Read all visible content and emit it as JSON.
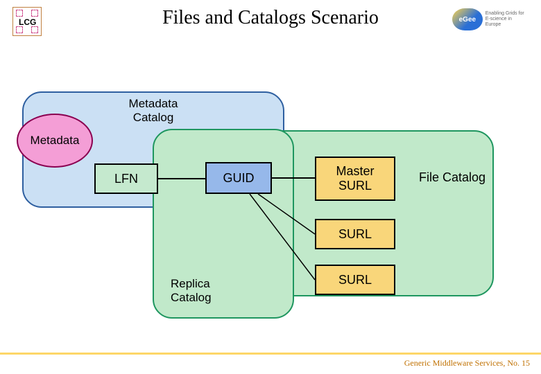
{
  "header": {
    "lcg_label": "LCG",
    "title": "Files and Catalogs Scenario",
    "egee_mark": "eGee",
    "egee_tagline_1": "Enabling Grids for",
    "egee_tagline_2": "E-science in Europe"
  },
  "diagram": {
    "metadata_catalog_label": "Metadata\nCatalog",
    "metadata_ellipse_label": "Metadata",
    "replica_catalog_label": "Replica\nCatalog",
    "file_catalog_label": "File Catalog",
    "nodes": {
      "lfn": "LFN",
      "guid": "GUID",
      "master_surl": "Master\nSURL",
      "surl_2": "SURL",
      "surl_3": "SURL"
    }
  },
  "footer": {
    "text": "Generic Middleware Services, No. 15"
  },
  "colors": {
    "metadata_container_fill": "#cbe0f4",
    "metadata_container_border": "#2e5fa0",
    "green_container_fill": "#c1e9ca",
    "green_container_border": "#1e965f",
    "metadata_ellipse_fill": "#f49ed6",
    "lfn_fill": "#c5e9ce",
    "guid_fill": "#96b8ea",
    "surl_fill": "#f9d67a",
    "footer_accent": "#fdd668"
  }
}
